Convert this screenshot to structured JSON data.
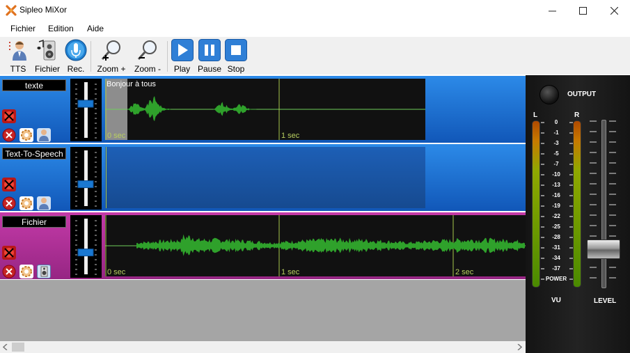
{
  "window": {
    "title": "Sipleo MiXor",
    "controls": {
      "minimize": "—",
      "maximize": "☐",
      "close": "✕"
    }
  },
  "menu": [
    "Fichier",
    "Edition",
    "Aide"
  ],
  "toolbar": {
    "tts": "TTS",
    "fichier": "Fichier",
    "rec": "Rec.",
    "zoom_in": "Zoom +",
    "zoom_out": "Zoom -",
    "play": "Play",
    "pause": "Pause",
    "stop": "Stop"
  },
  "tracks": [
    {
      "name": "texte",
      "caption": "Bonjour à tous",
      "time_labels": [
        "0 sec",
        "1 sec"
      ],
      "color": "#1a6fd6",
      "fader_level": 0.3
    },
    {
      "name": "Text-To-Speech",
      "caption": "",
      "time_labels": [],
      "color": "#1a6fd6",
      "fader_level": 0.52
    },
    {
      "name": "Fichier",
      "caption": "",
      "time_labels": [
        "0 sec",
        "1 sec",
        "2 sec"
      ],
      "color": "#b2309a",
      "fader_level": 0.52
    }
  ],
  "mixer": {
    "output_label": "OUTPUT",
    "left_label": "L",
    "right_label": "R",
    "scale": [
      "0",
      "-1",
      "-3",
      "-5",
      "-7",
      "-10",
      "-13",
      "-16",
      "-19",
      "-22",
      "-25",
      "-28",
      "-31",
      "-34",
      "-37",
      "POWER"
    ],
    "vu_label": "VU",
    "level_label": "LEVEL",
    "level_value": 0.18
  },
  "colors": {
    "wave_green": "#2fa12b",
    "blue_track": "#1a6fd6",
    "magenta_track": "#b2309a",
    "mixer_bg": "#1c1c1c"
  }
}
